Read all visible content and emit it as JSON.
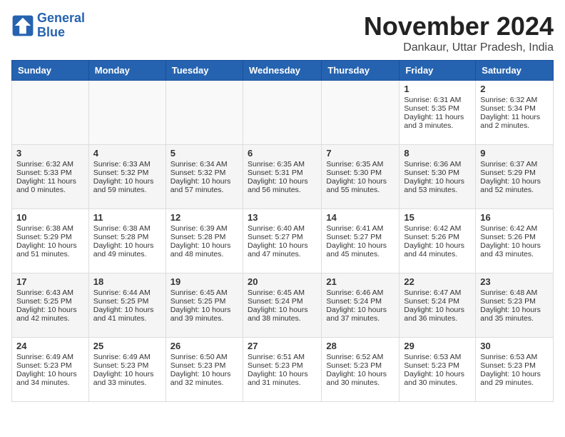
{
  "logo": {
    "line1": "General",
    "line2": "Blue"
  },
  "title": "November 2024",
  "location": "Dankaur, Uttar Pradesh, India",
  "days_of_week": [
    "Sunday",
    "Monday",
    "Tuesday",
    "Wednesday",
    "Thursday",
    "Friday",
    "Saturday"
  ],
  "weeks": [
    [
      {
        "day": "",
        "info": ""
      },
      {
        "day": "",
        "info": ""
      },
      {
        "day": "",
        "info": ""
      },
      {
        "day": "",
        "info": ""
      },
      {
        "day": "",
        "info": ""
      },
      {
        "day": "1",
        "info": "Sunrise: 6:31 AM\nSunset: 5:35 PM\nDaylight: 11 hours and 3 minutes."
      },
      {
        "day": "2",
        "info": "Sunrise: 6:32 AM\nSunset: 5:34 PM\nDaylight: 11 hours and 2 minutes."
      }
    ],
    [
      {
        "day": "3",
        "info": "Sunrise: 6:32 AM\nSunset: 5:33 PM\nDaylight: 11 hours and 0 minutes."
      },
      {
        "day": "4",
        "info": "Sunrise: 6:33 AM\nSunset: 5:32 PM\nDaylight: 10 hours and 59 minutes."
      },
      {
        "day": "5",
        "info": "Sunrise: 6:34 AM\nSunset: 5:32 PM\nDaylight: 10 hours and 57 minutes."
      },
      {
        "day": "6",
        "info": "Sunrise: 6:35 AM\nSunset: 5:31 PM\nDaylight: 10 hours and 56 minutes."
      },
      {
        "day": "7",
        "info": "Sunrise: 6:35 AM\nSunset: 5:30 PM\nDaylight: 10 hours and 55 minutes."
      },
      {
        "day": "8",
        "info": "Sunrise: 6:36 AM\nSunset: 5:30 PM\nDaylight: 10 hours and 53 minutes."
      },
      {
        "day": "9",
        "info": "Sunrise: 6:37 AM\nSunset: 5:29 PM\nDaylight: 10 hours and 52 minutes."
      }
    ],
    [
      {
        "day": "10",
        "info": "Sunrise: 6:38 AM\nSunset: 5:29 PM\nDaylight: 10 hours and 51 minutes."
      },
      {
        "day": "11",
        "info": "Sunrise: 6:38 AM\nSunset: 5:28 PM\nDaylight: 10 hours and 49 minutes."
      },
      {
        "day": "12",
        "info": "Sunrise: 6:39 AM\nSunset: 5:28 PM\nDaylight: 10 hours and 48 minutes."
      },
      {
        "day": "13",
        "info": "Sunrise: 6:40 AM\nSunset: 5:27 PM\nDaylight: 10 hours and 47 minutes."
      },
      {
        "day": "14",
        "info": "Sunrise: 6:41 AM\nSunset: 5:27 PM\nDaylight: 10 hours and 45 minutes."
      },
      {
        "day": "15",
        "info": "Sunrise: 6:42 AM\nSunset: 5:26 PM\nDaylight: 10 hours and 44 minutes."
      },
      {
        "day": "16",
        "info": "Sunrise: 6:42 AM\nSunset: 5:26 PM\nDaylight: 10 hours and 43 minutes."
      }
    ],
    [
      {
        "day": "17",
        "info": "Sunrise: 6:43 AM\nSunset: 5:25 PM\nDaylight: 10 hours and 42 minutes."
      },
      {
        "day": "18",
        "info": "Sunrise: 6:44 AM\nSunset: 5:25 PM\nDaylight: 10 hours and 41 minutes."
      },
      {
        "day": "19",
        "info": "Sunrise: 6:45 AM\nSunset: 5:25 PM\nDaylight: 10 hours and 39 minutes."
      },
      {
        "day": "20",
        "info": "Sunrise: 6:45 AM\nSunset: 5:24 PM\nDaylight: 10 hours and 38 minutes."
      },
      {
        "day": "21",
        "info": "Sunrise: 6:46 AM\nSunset: 5:24 PM\nDaylight: 10 hours and 37 minutes."
      },
      {
        "day": "22",
        "info": "Sunrise: 6:47 AM\nSunset: 5:24 PM\nDaylight: 10 hours and 36 minutes."
      },
      {
        "day": "23",
        "info": "Sunrise: 6:48 AM\nSunset: 5:23 PM\nDaylight: 10 hours and 35 minutes."
      }
    ],
    [
      {
        "day": "24",
        "info": "Sunrise: 6:49 AM\nSunset: 5:23 PM\nDaylight: 10 hours and 34 minutes."
      },
      {
        "day": "25",
        "info": "Sunrise: 6:49 AM\nSunset: 5:23 PM\nDaylight: 10 hours and 33 minutes."
      },
      {
        "day": "26",
        "info": "Sunrise: 6:50 AM\nSunset: 5:23 PM\nDaylight: 10 hours and 32 minutes."
      },
      {
        "day": "27",
        "info": "Sunrise: 6:51 AM\nSunset: 5:23 PM\nDaylight: 10 hours and 31 minutes."
      },
      {
        "day": "28",
        "info": "Sunrise: 6:52 AM\nSunset: 5:23 PM\nDaylight: 10 hours and 30 minutes."
      },
      {
        "day": "29",
        "info": "Sunrise: 6:53 AM\nSunset: 5:23 PM\nDaylight: 10 hours and 30 minutes."
      },
      {
        "day": "30",
        "info": "Sunrise: 6:53 AM\nSunset: 5:23 PM\nDaylight: 10 hours and 29 minutes."
      }
    ]
  ]
}
